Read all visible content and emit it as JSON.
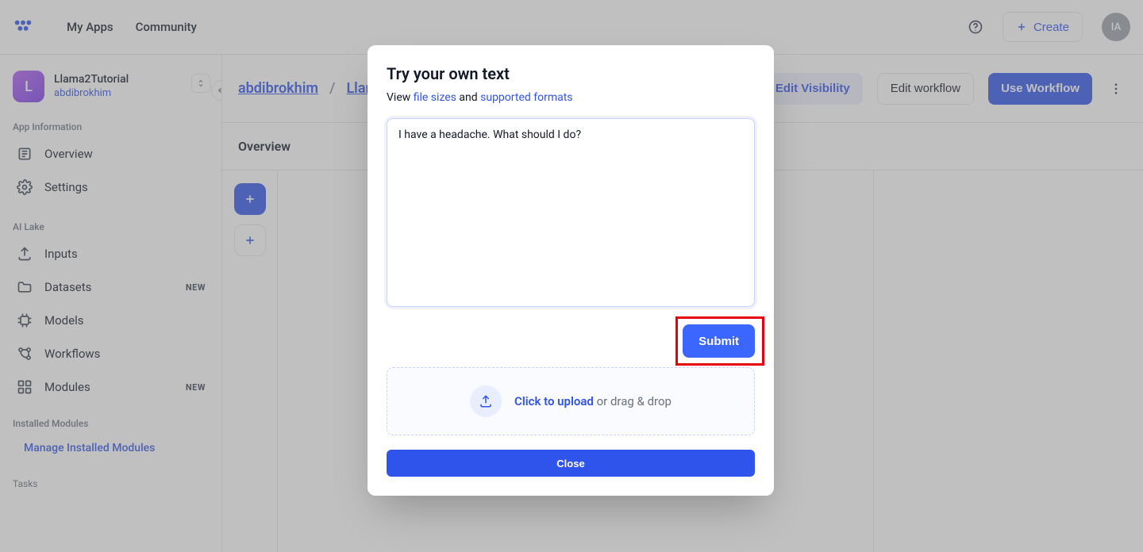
{
  "topbar": {
    "nav": {
      "my_apps": "My Apps",
      "community": "Community"
    },
    "create_label": "Create",
    "avatar_initials": "IA"
  },
  "sidebar": {
    "app": {
      "initial": "L",
      "title": "Llama2Tutorial",
      "user": "abdibrokhim"
    },
    "section_app_info": "App Information",
    "items_app_info": [
      {
        "label": "Overview"
      },
      {
        "label": "Settings"
      }
    ],
    "section_ai_lake": "AI Lake",
    "items_ai_lake": [
      {
        "label": "Inputs",
        "badge": ""
      },
      {
        "label": "Datasets",
        "badge": "NEW"
      },
      {
        "label": "Models",
        "badge": ""
      },
      {
        "label": "Workflows",
        "badge": ""
      },
      {
        "label": "Modules",
        "badge": "NEW"
      }
    ],
    "section_installed": "Installed Modules",
    "manage_link": "Manage Installed Modules",
    "section_tasks": "Tasks"
  },
  "page": {
    "crumb1": "abdibrokhim",
    "crumb2": "Llam",
    "btn_visibility": "Edit Visibility",
    "btn_edit_workflow": "Edit workflow",
    "btn_use_workflow": "Use Workflow",
    "tab_overview": "Overview"
  },
  "modal": {
    "title": "Try your own text",
    "helper_prefix": "View ",
    "helper_link1": "file sizes",
    "helper_mid": " and ",
    "helper_link2": "supported formats",
    "textarea_value": "I have a headache. What should I do?",
    "submit_label": "Submit",
    "upload_strong": "Click to upload",
    "upload_rest": " or drag & drop",
    "close_label": "Close"
  }
}
